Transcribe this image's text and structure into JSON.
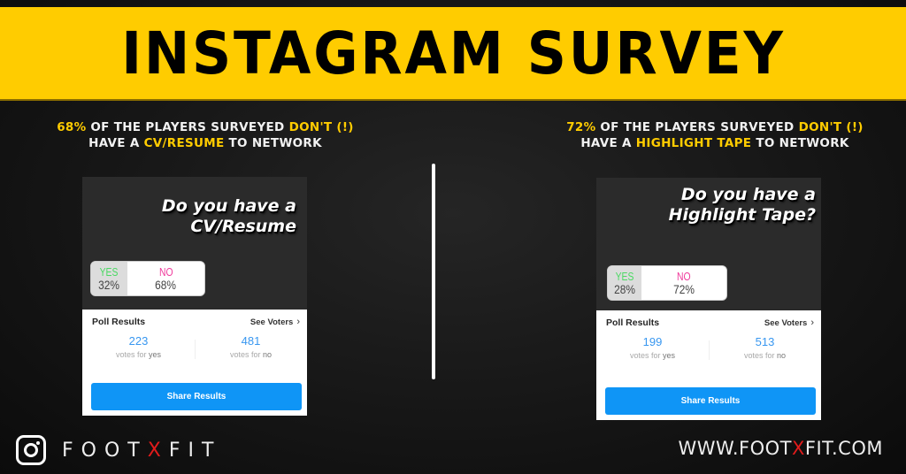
{
  "banner": {
    "title": "INSTAGRAM SURVEY",
    "color": "#ffcc00"
  },
  "headlines": {
    "left": {
      "line1": {
        "stat": "68%",
        "text": " OF THE PLAYERS SURVEYED ",
        "emph": "DON'T (!)"
      },
      "line2": {
        "pre": "HAVE A ",
        "emph": "CV/RESUME",
        "post": " TO NETWORK"
      }
    },
    "right": {
      "line1": {
        "stat": "72%",
        "text": " OF THE PLAYERS SURVEYED ",
        "emph": "DON'T (!)"
      },
      "line2": {
        "pre": "HAVE A ",
        "emph": "HIGHLIGHT TAPE",
        "post": " TO NETWORK"
      }
    }
  },
  "polls": [
    {
      "question_lines": [
        "Do you have a",
        "CV/Resume"
      ],
      "options": {
        "yes": {
          "label": "YES",
          "percent": "32%",
          "share": 0.32
        },
        "no": {
          "label": "NO",
          "percent": "68%",
          "share": 0.68
        }
      },
      "results": {
        "title": "Poll Results",
        "see_voters": "See Voters",
        "yes_count": "223",
        "yes_label_pre": "votes for ",
        "yes_label_word": "yes",
        "no_count": "481",
        "no_label_pre": "votes for ",
        "no_label_word": "no",
        "share_button": "Share Results"
      }
    },
    {
      "question_lines": [
        "Do you have a",
        "Highlight Tape?"
      ],
      "options": {
        "yes": {
          "label": "YES",
          "percent": "28%",
          "share": 0.28
        },
        "no": {
          "label": "NO",
          "percent": "72%",
          "share": 0.72
        }
      },
      "results": {
        "title": "Poll Results",
        "see_voters": "See Voters",
        "yes_count": "199",
        "yes_label_pre": "votes for ",
        "yes_label_word": "yes",
        "no_count": "513",
        "no_label_pre": "votes for ",
        "no_label_word": "no",
        "share_button": "Share Results"
      }
    }
  ],
  "footer": {
    "brand_pre": "FOOT",
    "brand_x": "X",
    "brand_post": "FIT",
    "url_pre": "WWW.FOOT",
    "url_x": "X",
    "url_post": "FIT.COM",
    "accent_red": "#e01b1b"
  },
  "colors": {
    "accent_yellow": "#ffcc00",
    "instagram_blue": "#0f95f6",
    "count_blue": "#3897f0",
    "yes_green": "#4cd964",
    "no_pink": "#f03a9c"
  }
}
